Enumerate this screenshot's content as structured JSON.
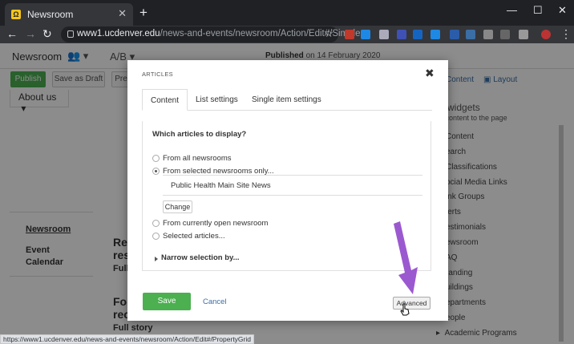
{
  "browser": {
    "tab_title": "Newsroom",
    "url_domain": "www1.ucdenver.edu",
    "url_path": "/news-and-events/newsroom/Action/Edit#/Simple",
    "status_url": "https://www1.ucdenver.edu/news-and-events/newsroom/Action/Edit#/PropertyGrid"
  },
  "cms": {
    "site_name": "Newsroom",
    "ab_label": "A/B",
    "published_label": "Published",
    "published_date": "on 14 February 2020",
    "publish_button": "Publish",
    "save_draft_button": "Save as Draft",
    "preview_button": "Pre",
    "content_link": "Content",
    "layout_link": "Layout",
    "about_us": "About us",
    "side_nav": [
      "Newsroom",
      "Event Calendar"
    ],
    "articles": [
      {
        "title_part": "Re",
        "title_part2": "res",
        "sub": "Full"
      },
      {
        "title_part": "Fo",
        "title_part2": "rec",
        "sub": "Full story"
      }
    ],
    "widgets_heading": "g widgets",
    "widgets_sub": "d content to the page",
    "widgets": [
      "Content",
      "earch",
      "Classifications",
      "ocial Media Links",
      "ink Groups",
      "lerts",
      "estimonials",
      "ewsroom",
      "AQ",
      "randing",
      "uildings",
      "epartments",
      "eople",
      "Academic Programs"
    ]
  },
  "modal": {
    "title": "ARTICLES",
    "tabs": [
      "Content",
      "List settings",
      "Single item settings"
    ],
    "active_tab": "Content",
    "question": "Which articles to display?",
    "options": [
      "From all newsrooms",
      "From selected newsrooms only...",
      "From currently open newsroom",
      "Selected articles..."
    ],
    "selected_option": "From selected newsrooms only...",
    "selected_site": "Public Health Main Site News",
    "change_button": "Change",
    "narrow_label": "Narrow selection by...",
    "save_button": "Save",
    "cancel_link": "Cancel",
    "advanced_button": "Advanced"
  },
  "colors": {
    "accent_green": "#4caf50",
    "link_blue": "#3a6ea5",
    "annotation_arrow": "#9b59d0"
  }
}
